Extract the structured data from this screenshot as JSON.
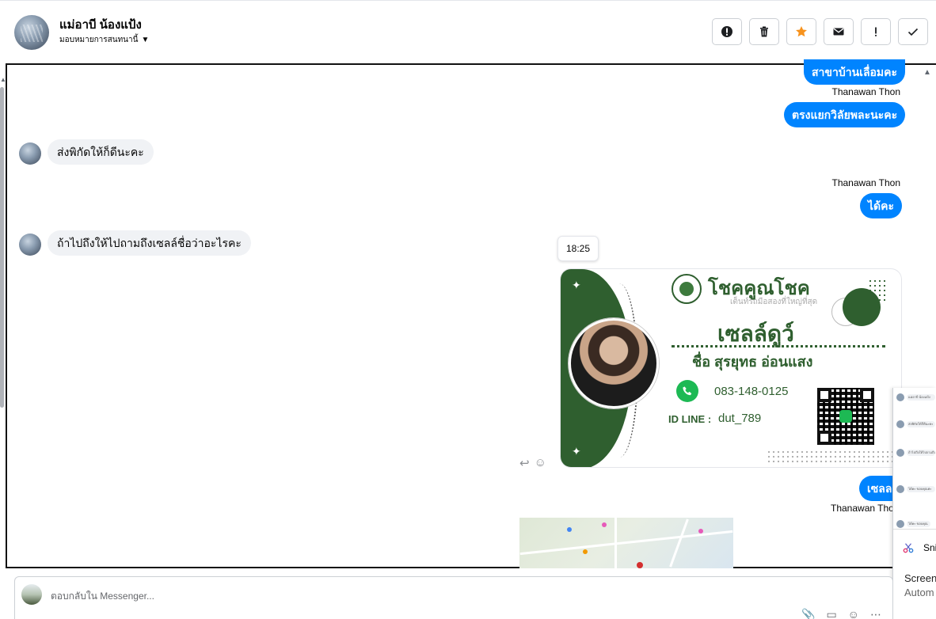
{
  "header": {
    "contact_name": "แม่อาบี น้องแป้ง",
    "assign_label": "มอบหมายการสนทนานี้",
    "assign_caret": "▼"
  },
  "toolbar": {
    "buttons": [
      {
        "name": "alert-icon"
      },
      {
        "name": "trash-icon"
      },
      {
        "name": "star-icon",
        "color": "#f7931e"
      },
      {
        "name": "envelope-icon"
      },
      {
        "name": "exclamation-icon"
      },
      {
        "name": "check-icon"
      }
    ]
  },
  "messages": {
    "m1": "สาขาบ้านเลื่อมคะ",
    "s1": "Thanawan Thon",
    "m2": "ตรงแยกวิลัยพละนะคะ",
    "in1": "ส่งพิกัดให้ก็ดีนะคะ",
    "s2": "Thanawan Thon",
    "m3": "ได้คะ",
    "in2": "ถ้าไปถึงให้ไปถามถึงเซลล์ชื่อว่าอะไรคะ",
    "time": "18:25",
    "m4": "เซลล",
    "s3": "Thanawan Tho"
  },
  "card": {
    "brand": "โชคคูณโชค",
    "brand_sub": "เต็นท์รถมือสองที่ใหญ่ที่สุด",
    "title": "เซลล์ดูว์",
    "fullname": "ชื่อ สุรยุทธ  อ่อนแสง",
    "phone": "083-148-0125",
    "line_label": "ID LINE :",
    "line_id": "dut_789"
  },
  "side_panel": {
    "mini_messages": [
      "แม่อาบี น้องแป้ง",
      "ส่งพิกัดให้ก็ดีนะคะ",
      "ถ้าไปถึงให้ไปถามถึงเซลล์",
      "ได้คะ ขอบคุณค่ะ",
      "ได้คะ ขอบคุณ"
    ],
    "notif_app": "Sni",
    "notif_line1": "Screen",
    "notif_line2": "Autom"
  },
  "reply": {
    "placeholder": "ตอบกลับใน Messenger..."
  },
  "colors": {
    "accent": "#0084ff",
    "card_green": "#2f5f2f",
    "star": "#f7931e"
  }
}
